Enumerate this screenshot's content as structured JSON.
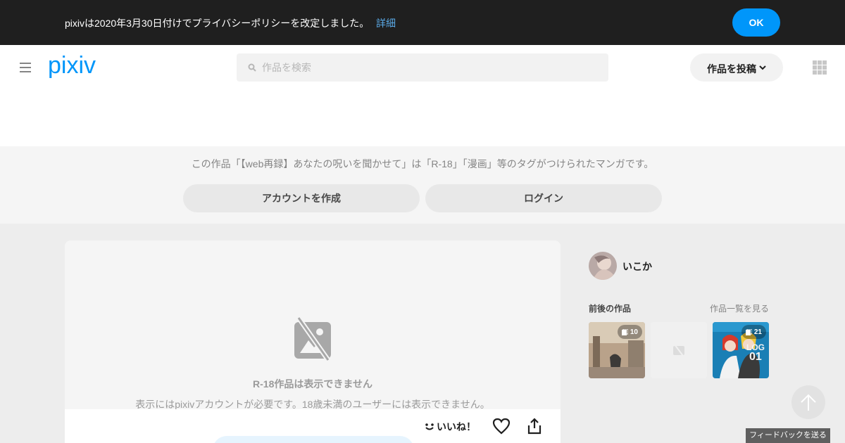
{
  "notice": {
    "text": "pixivは2020年3月30日付けでプライバシーポリシーを改定しました。",
    "link_label": "詳細",
    "ok_label": "OK"
  },
  "header": {
    "logo_text": "pixiv",
    "search_placeholder": "作品を検索",
    "post_label": "作品を投稿"
  },
  "r18_notice": {
    "text": "この作品「【web再録】あなたの呪いを聞かせて」は「R-18」「漫画」等のタグがつけられたマンガです。",
    "create_account_label": "アカウントを作成",
    "login_label": "ログイン"
  },
  "artwork": {
    "title": "R-18作品は表示できません",
    "description": "表示にはpixivアカウントが必要です。18歳未満のユーザーには表示できません。",
    "like_label": "いいね！"
  },
  "sidebar": {
    "username": "いこか",
    "section_title": "前後の作品",
    "see_all_label": "作品一覧を見る",
    "thumbnails": [
      {
        "page_count": "10"
      },
      {
        "page_count": ""
      },
      {
        "page_count": "21"
      }
    ]
  },
  "feedback_label": "フィードバックを送る",
  "colors": {
    "accent": "#0096fa",
    "notice_bg": "#1f1f1f",
    "link": "#5aa9e6"
  }
}
